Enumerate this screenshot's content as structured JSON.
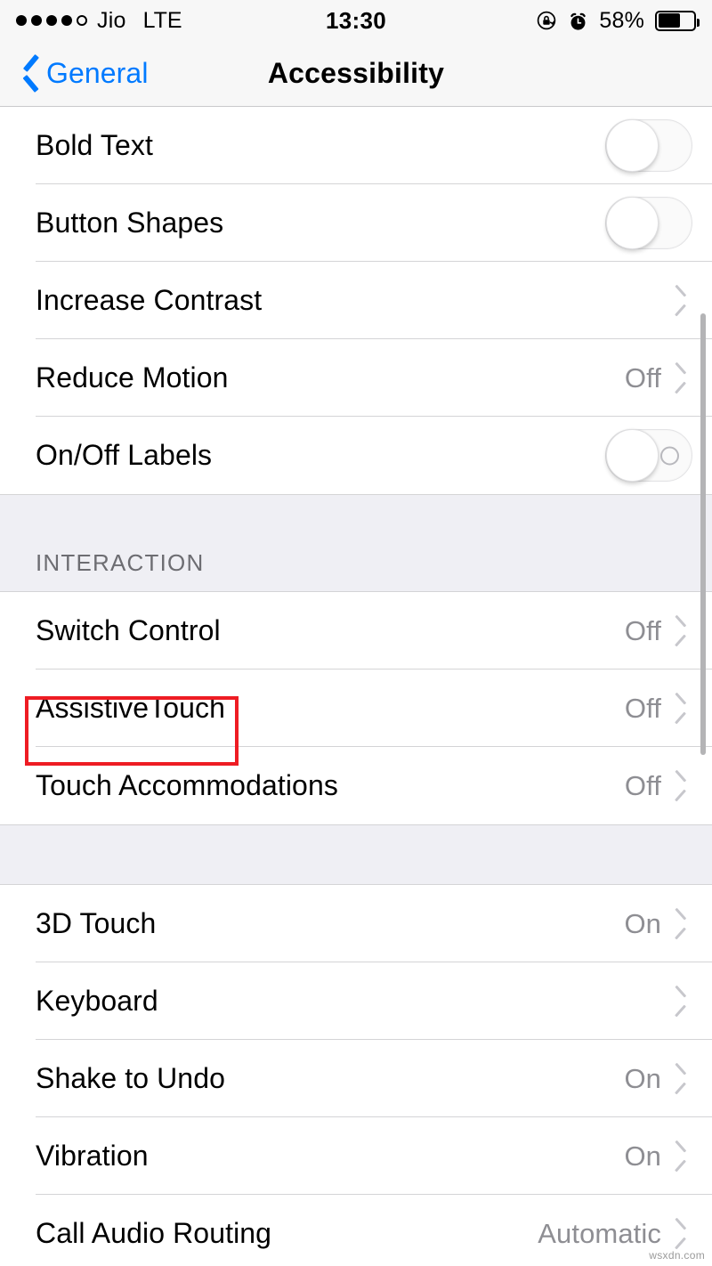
{
  "status_bar": {
    "signal_dots_filled": 4,
    "signal_dots_total": 5,
    "carrier": "Jio",
    "network": "LTE",
    "time": "13:30",
    "rotation_lock_icon": "rotation-lock-icon",
    "alarm_icon": "alarm-clock-icon",
    "battery_percent": "58%",
    "battery_level": 58
  },
  "nav": {
    "back_label": "General",
    "back_icon": "chevron-left-icon",
    "title": "Accessibility",
    "accent_color": "#007AFF"
  },
  "sections": [
    {
      "id": "vision-continued",
      "header": "",
      "rows": [
        {
          "label": "Bold Text",
          "value": "",
          "control": "toggle",
          "toggle_on": false,
          "toggle_labels": false
        },
        {
          "label": "Button Shapes",
          "value": "",
          "control": "toggle",
          "toggle_on": false,
          "toggle_labels": false
        },
        {
          "label": "Increase Contrast",
          "value": "",
          "control": "chevron"
        },
        {
          "label": "Reduce Motion",
          "value": "Off",
          "control": "chevron"
        },
        {
          "label": "On/Off Labels",
          "value": "",
          "control": "toggle",
          "toggle_on": false,
          "toggle_labels": true
        }
      ]
    },
    {
      "id": "interaction",
      "header": "INTERACTION",
      "rows": [
        {
          "label": "Switch Control",
          "value": "Off",
          "control": "chevron"
        },
        {
          "label": "AssistiveTouch",
          "value": "Off",
          "control": "chevron",
          "highlighted": true
        },
        {
          "label": "Touch Accommodations",
          "value": "Off",
          "control": "chevron"
        }
      ]
    },
    {
      "id": "touch-and-input",
      "header": "",
      "rows": [
        {
          "label": "3D Touch",
          "value": "On",
          "control": "chevron"
        },
        {
          "label": "Keyboard",
          "value": "",
          "control": "chevron"
        },
        {
          "label": "Shake to Undo",
          "value": "On",
          "control": "chevron"
        },
        {
          "label": "Vibration",
          "value": "On",
          "control": "chevron"
        },
        {
          "label": "Call Audio Routing",
          "value": "Automatic",
          "control": "chevron"
        }
      ]
    }
  ],
  "highlight": {
    "target": "AssistiveTouch",
    "color": "#EE1C23"
  },
  "watermark": "wsxdn.com"
}
